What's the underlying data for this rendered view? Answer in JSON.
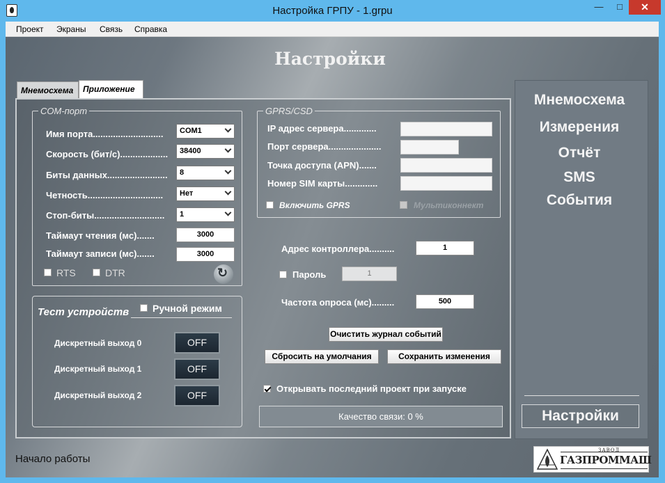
{
  "window": {
    "title": "Настройка ГРПУ - 1.grpu",
    "min": "—",
    "max": "□",
    "close": "✕"
  },
  "menu": [
    "Проект",
    "Экраны",
    "Связь",
    "Справка"
  ],
  "header": {
    "title": "Настройки"
  },
  "tabs": [
    "Мнемосхема",
    "Приложение"
  ],
  "com": {
    "legend": "COM-порт",
    "port_name": {
      "label": "Имя порта............................",
      "value": "COM1"
    },
    "speed": {
      "label": "Скорость (бит/с)...................",
      "value": "38400"
    },
    "data_bits": {
      "label": "Биты данных........................",
      "value": "8"
    },
    "parity": {
      "label": "Четность..............................",
      "value": "Нет"
    },
    "stop_bits": {
      "label": "Стоп-биты............................",
      "value": "1"
    },
    "read_timeout": {
      "label": "Таймаут чтения (мс).......",
      "value": "3000"
    },
    "write_timeout": {
      "label": "Таймаут записи (мс).......",
      "value": "3000"
    },
    "rts": "RTS",
    "dtr": "DTR"
  },
  "gprs": {
    "legend": "GPRS/CSD",
    "server_ip": "IP адрес сервера.............",
    "server_port": "Порт сервера.....................",
    "apn": "Точка доступа (APN).......",
    "sim": "Номер SIM карты.............",
    "enable_gprs": "Включить GPRS",
    "multiconnect": "Мультиконнект"
  },
  "controller_address": {
    "label": "Адрес контроллера..........",
    "value": "1"
  },
  "password": {
    "label": "Пароль",
    "value": "1"
  },
  "poll_rate": {
    "label": "Частота опроса (мс).........",
    "value": "500"
  },
  "device_test": {
    "title": "Тест устройств",
    "manual_mode": "Ручной режим",
    "outputs": [
      {
        "label": "Дискретный выход 0",
        "state": "OFF"
      },
      {
        "label": "Дискретный выход 1",
        "state": "OFF"
      },
      {
        "label": "Дискретный выход 2",
        "state": "OFF"
      }
    ]
  },
  "buttons": {
    "clear_log": "Очистить журнал событий",
    "reset_defaults": "Сбросить на умолчания",
    "save": "Сохранить изменения"
  },
  "open_last_project": "Открывать последний проект при запуске",
  "link_quality": "Качество связи: 0 %",
  "nav": [
    "Мнемосхема",
    "Измерения",
    "Отчёт",
    "SMS",
    "События",
    "Настройки"
  ],
  "status": "Начало работы",
  "logo": {
    "small": "ЗАВОД",
    "big": "ГАЗПРОММАШ"
  }
}
